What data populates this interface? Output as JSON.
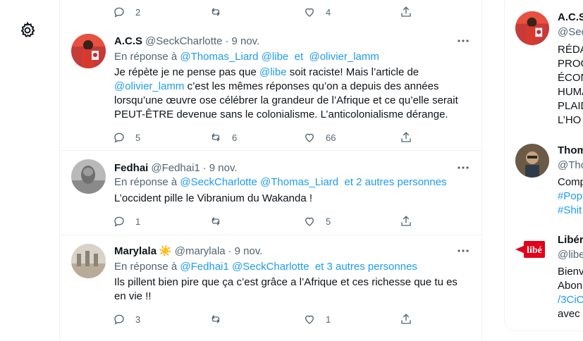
{
  "settings_icon": "gear-icon",
  "top_actions": {
    "reply_count": "2",
    "retweet_count": "",
    "like_count": "4"
  },
  "tweets": [
    {
      "name": "A.C.S",
      "handle": "@SeckCharlotte",
      "time": "9 nov.",
      "reply_prefix": "En réponse à",
      "reply_to": [
        "@Thomas_Liard",
        "@libe",
        "et",
        "@olivier_lamm"
      ],
      "body": {
        "p1": "Je répète je ne pense pas que ",
        "m1": "@libe",
        "p2": " soit raciste! Mais l’article de ",
        "m2": "@olivier_lamm",
        "p3": " c’est les mêmes réponses qu’on a depuis des années lorsqu’une œuvre ose célébrer la grandeur de l’Afrique et ce qu’elle serait PEUT-ÊTRE devenue sans le colonialisme. L’anticolonialisme dérange."
      },
      "reply_count": "5",
      "retweet_count": "6",
      "like_count": "66"
    },
    {
      "name": "Fedhai",
      "handle": "@Fedhai1",
      "time": "9 nov.",
      "reply_prefix": "En réponse à",
      "reply_to": [
        "@SeckCharlotte",
        "@Thomas_Liard",
        "et 2 autres personnes"
      ],
      "body": "L’occident pille le Vibranium du Wakanda !",
      "reply_count": "1",
      "retweet_count": "",
      "like_count": "5"
    },
    {
      "name": "Marylala",
      "name_emoji": "☀️",
      "handle": "@marylala",
      "time": "9 nov.",
      "reply_prefix": "En réponse à",
      "reply_to": [
        "@Fedhai1",
        "@SeckCharlotte",
        "et 3 autres personnes"
      ],
      "body": "Ils pillent bien pire que ça c’est grâce a l’Afrique et ces richesse  que tu es en vie !!",
      "reply_count": "3",
      "retweet_count": "",
      "like_count": "1"
    }
  ],
  "sidebar": {
    "accounts": [
      {
        "name": "A.C.S",
        "handle": "@Seck",
        "lines": [
          "RÉDA",
          "PROG",
          "ÉCON",
          "HUMA",
          "PLAID",
          "L’HO"
        ]
      },
      {
        "name": "Thom",
        "handle": "@Tho",
        "lines": [
          "Comp",
          "#Pop",
          "#Shit"
        ]
      },
      {
        "name": "Libér",
        "handle": "@libe",
        "lines": [
          "Bienv",
          "Abon",
          "/3CiC",
          "avec"
        ],
        "logo_text": "libé"
      }
    ]
  },
  "colors": {
    "accent": "#1d9bf0",
    "muted": "#536471",
    "text": "#0f1419",
    "border": "#eff3f4"
  }
}
